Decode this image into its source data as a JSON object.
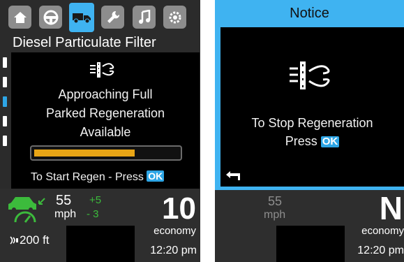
{
  "left_screen": {
    "tabs": [
      {
        "icon": "home-icon"
      },
      {
        "icon": "steering-wheel-icon"
      },
      {
        "icon": "truck-icon",
        "active": true
      },
      {
        "icon": "wrench-icon"
      },
      {
        "icon": "music-note-icon"
      },
      {
        "icon": "settings-gear-icon"
      }
    ],
    "title": "Diesel Particulate Filter",
    "dpf_icon": "dpf-filter-icon",
    "message_lines": [
      "Approaching Full",
      "Parked Regeneration",
      "Available"
    ],
    "regen_progress": 0.7,
    "start_regen_text": "To Start Regen - Press",
    "ok_label": "OK",
    "status": {
      "speed": "55",
      "speed_unit": "mph",
      "delta_plus": "+5",
      "delta_minus": "- 3",
      "gear": "10",
      "mode": "economy",
      "time": "12:20 pm",
      "follow_distance": "200 ft"
    },
    "colors": {
      "accent": "#3fb3f1",
      "progress": "#e8a516",
      "green": "#3cbb3c"
    }
  },
  "right_screen": {
    "title": "Notice",
    "notice_icon": "dpf-filter-icon",
    "message_lines": [
      "To Stop Regeneration"
    ],
    "press_text": "Press",
    "ok_label": "OK",
    "back_icon": "back-arrow-icon",
    "status": {
      "speed": "55",
      "speed_unit": "mph",
      "gear": "N",
      "mode": "economy",
      "time": "12:20 pm"
    }
  }
}
